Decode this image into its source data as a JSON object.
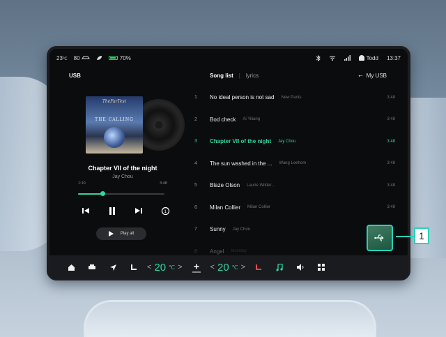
{
  "status": {
    "temperature": "23",
    "temp_unit": "℃",
    "range": "80",
    "battery": "70%",
    "user": "Todd",
    "time": "13:37",
    "accent_color": "#2fd6a2"
  },
  "header": {
    "source": "USB",
    "tab_active": "Song list",
    "tab_separator": "|",
    "tab_inactive": "lyrics",
    "my_usb": "My USB"
  },
  "now_playing": {
    "album_logo": "TheFarTest",
    "album_name": "THE CALLING",
    "title": "Chapter VII of the night",
    "artist": "Jay Chou",
    "elapsed": "1:10",
    "duration": "3:48",
    "progress": 0.28,
    "play_all": "Play all"
  },
  "songs": [
    {
      "num": "1",
      "title": "No ideal person is not sad",
      "artist": "New Pants",
      "dur": "3:48"
    },
    {
      "num": "2",
      "title": "Bod check",
      "artist": "Ai Yiliang",
      "dur": "3:48"
    },
    {
      "num": "3",
      "title": "Chapter VII of the night",
      "artist": "Jay Chou",
      "dur": "3:48"
    },
    {
      "num": "4",
      "title": "The sun washed in the ...",
      "artist": "Wang Leehom",
      "dur": "3:48"
    },
    {
      "num": "5",
      "title": "Blaze Olson",
      "artist": "Laurie Wilder...",
      "dur": "3:48"
    },
    {
      "num": "6",
      "title": "Milan Collier",
      "artist": "Milan Collier",
      "dur": "3:48"
    },
    {
      "num": "7",
      "title": "Sunny",
      "artist": "Jay Chou",
      "dur": ""
    },
    {
      "num": "8",
      "title": "Angel",
      "artist": "Moxiday",
      "dur": ""
    }
  ],
  "dock": {
    "temp_left": "20",
    "temp_right": "20",
    "deg": "℃",
    "left_arrow": "<",
    "right_arrow": ">"
  },
  "callout": {
    "label": "1"
  },
  "icons": {
    "home": "home-icon",
    "car": "car-icon",
    "nav": "navigation-icon",
    "seat": "seat-heat-icon",
    "fan": "fan-icon",
    "music": "music-icon",
    "volume": "volume-icon",
    "apps": "apps-icon",
    "usb": "usb-icon"
  }
}
